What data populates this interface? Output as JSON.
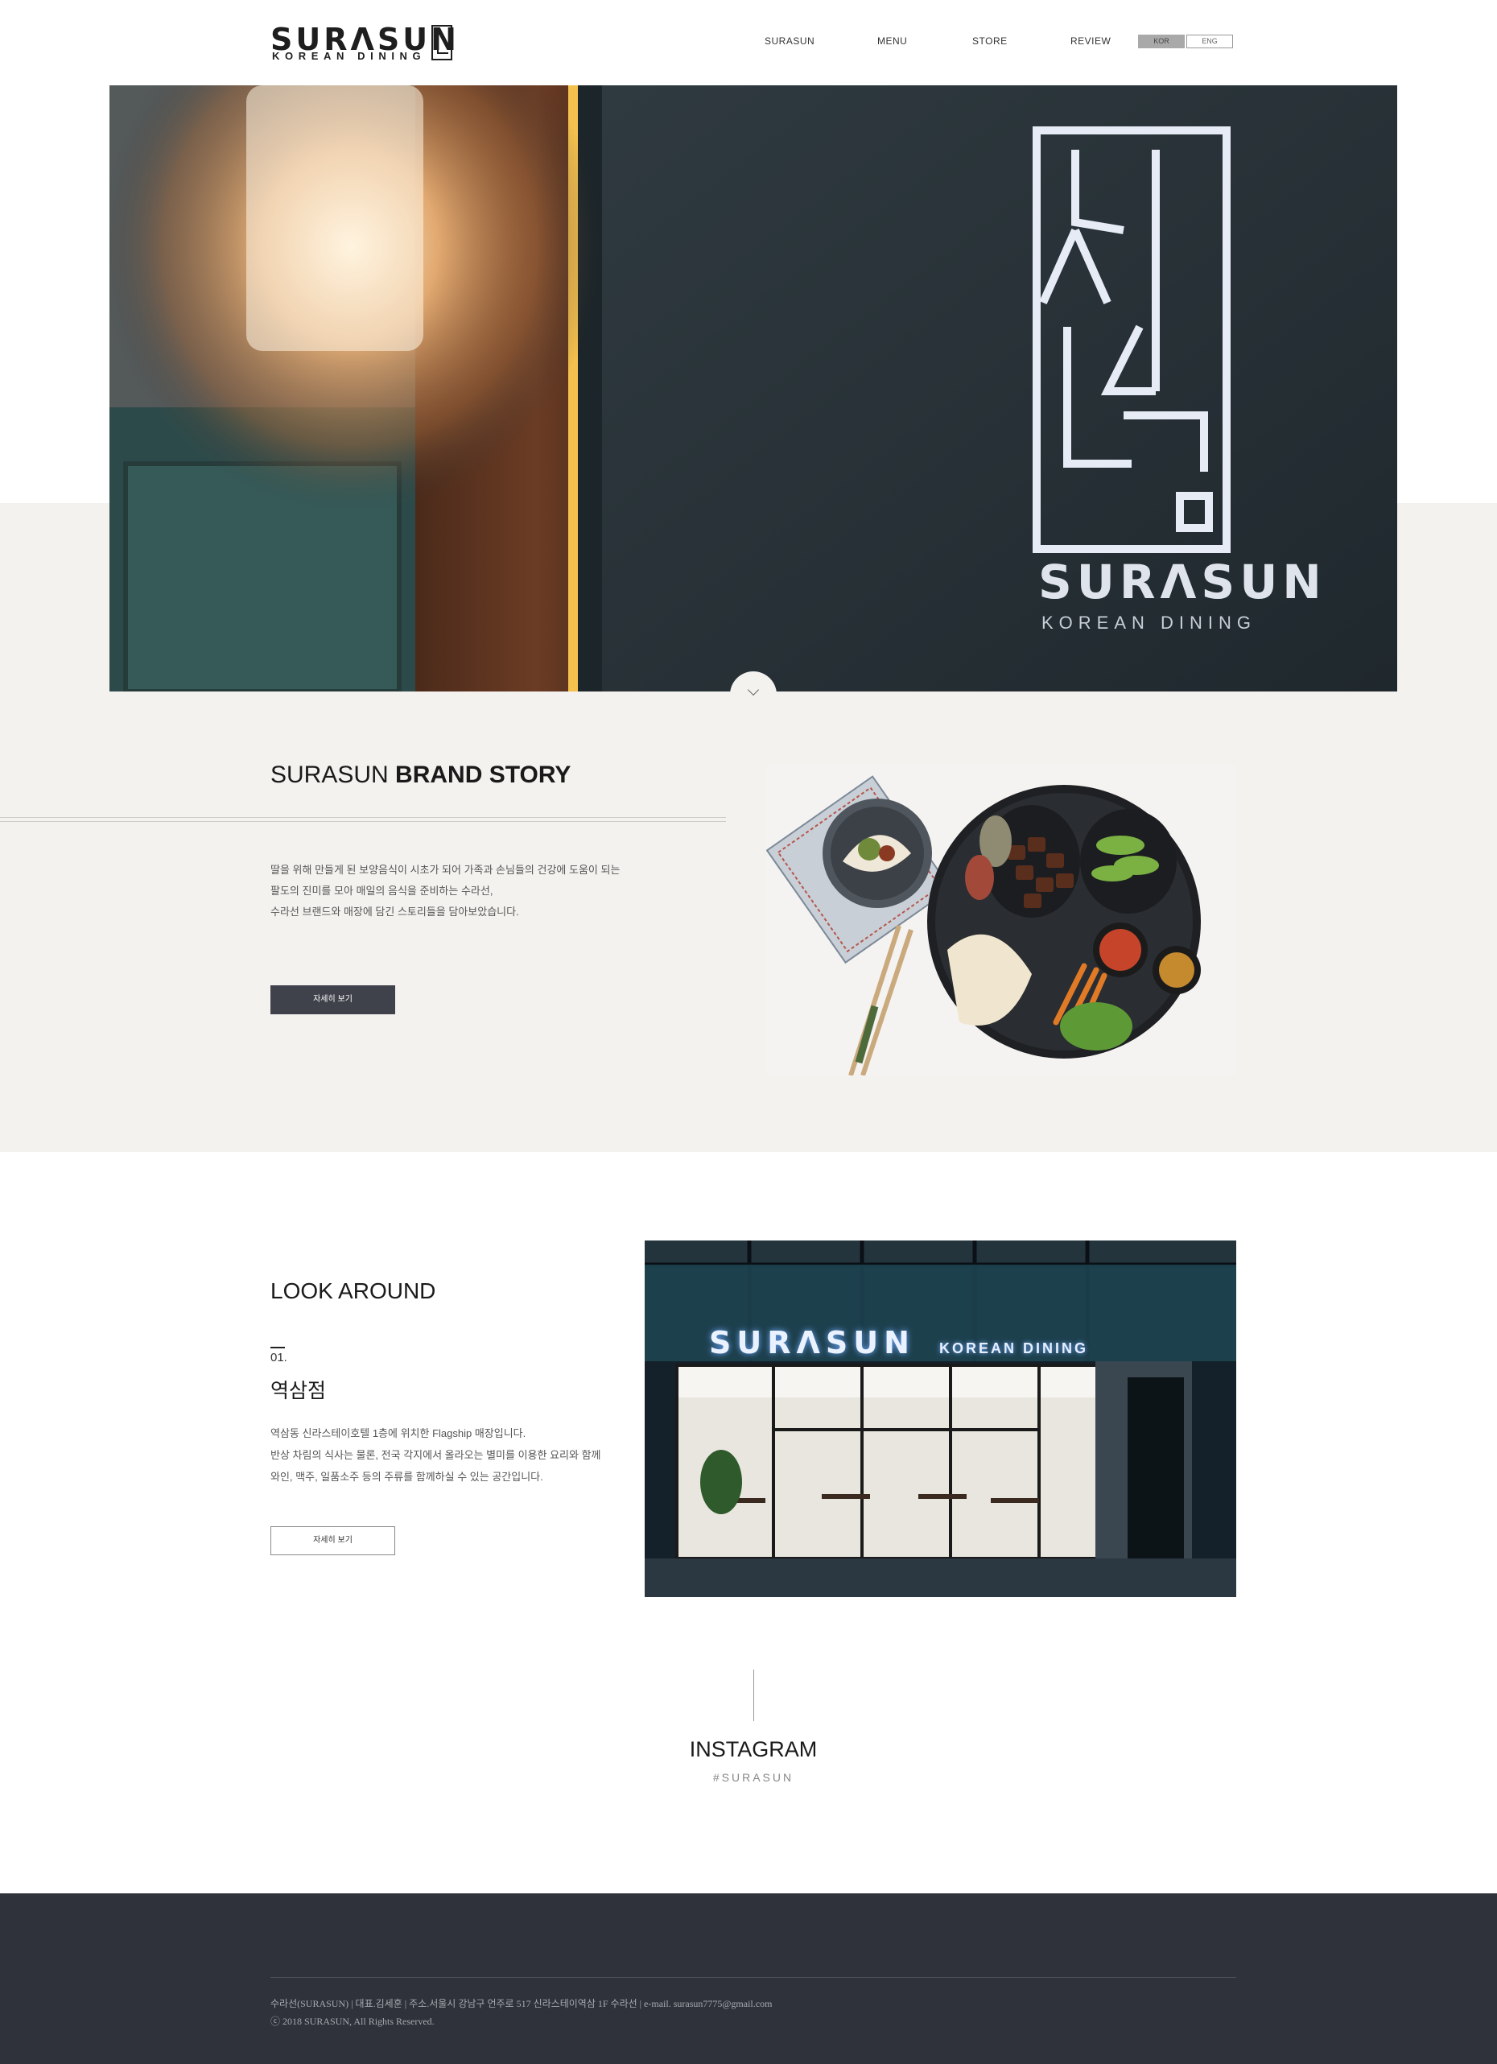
{
  "header": {
    "logo_main": "SURΛSUN",
    "logo_sub": "KOREAN DINING",
    "nav": [
      "SURASUN",
      "MENU",
      "STORE",
      "REVIEW"
    ],
    "lang_kor": "KOR",
    "lang_eng": "ENG"
  },
  "hero": {
    "sign_title": "SURΛSUN",
    "sign_sub": "KOREAN DINING"
  },
  "brand": {
    "title_light": "SURASUN ",
    "title_bold": "BRAND STORY",
    "lines": [
      "딸을 위해 만들게 된 보양음식이 시초가 되어 가족과 손님들의 건강에 도움이 되는",
      "팔도의 진미를 모아 매일의 음식을 준비하는 수라선,",
      "수라선 브랜드와 매장에 담긴 스토리들을 담아보았습니다."
    ],
    "button": "자세히 보기"
  },
  "look": {
    "title": "LOOK AROUND",
    "num": "01.",
    "store_name": "역삼점",
    "lines": [
      "역삼동 신라스테이호텔 1층에 위치한 Flagship 매장입니다.",
      "반상 차림의 식사는 물론, 전국 각지에서 올라오는 별미를 이용한 요리와 함께",
      "와인, 맥주, 일품소주 등의 주류를 함께하실 수 있는 공간입니다."
    ],
    "button": "자세히 보기",
    "photo_sign": "SURΛSUN",
    "photo_sign_sub": "KOREAN DINING"
  },
  "instagram": {
    "title": "INSTAGRAM",
    "tag": "#SURASUN"
  },
  "footer": {
    "info": "수라선(SURASUN) | 대표.김세훈 | 주소.서울시 강남구 언주로 517 신라스테이역삼 1F 수라선 | e-mail. surasun7775@gmail.com",
    "copyright": "ⓒ 2018 SURASUN, All Rights Reserved."
  }
}
